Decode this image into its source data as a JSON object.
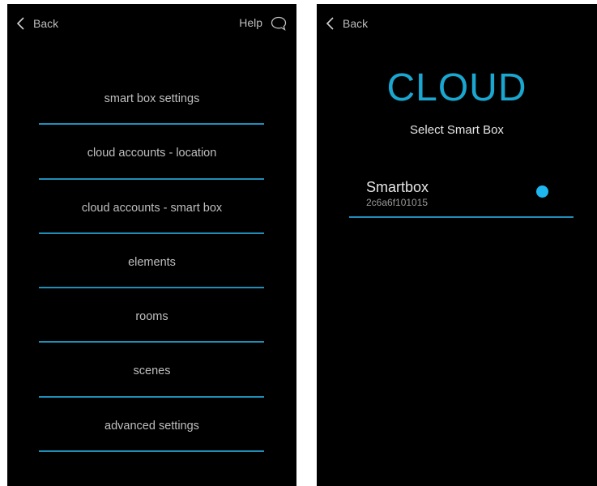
{
  "colors": {
    "accent": "#1f8fb8",
    "title_color": "#1aa6cf",
    "selected_dot": "#1eb6ee",
    "background": "#000000"
  },
  "left_screen": {
    "back_label": "Back",
    "help_label": "Help",
    "menu_items": [
      {
        "label": "smart box settings"
      },
      {
        "label": "cloud accounts - location"
      },
      {
        "label": "cloud accounts - smart box"
      },
      {
        "label": "elements"
      },
      {
        "label": "rooms"
      },
      {
        "label": "scenes"
      },
      {
        "label": "advanced settings"
      }
    ]
  },
  "right_screen": {
    "back_label": "Back",
    "title": "CLOUD",
    "subtitle": "Select Smart Box",
    "smart_boxes": [
      {
        "name": "Smartbox",
        "id": "2c6a6f101015",
        "selected": true
      }
    ]
  }
}
